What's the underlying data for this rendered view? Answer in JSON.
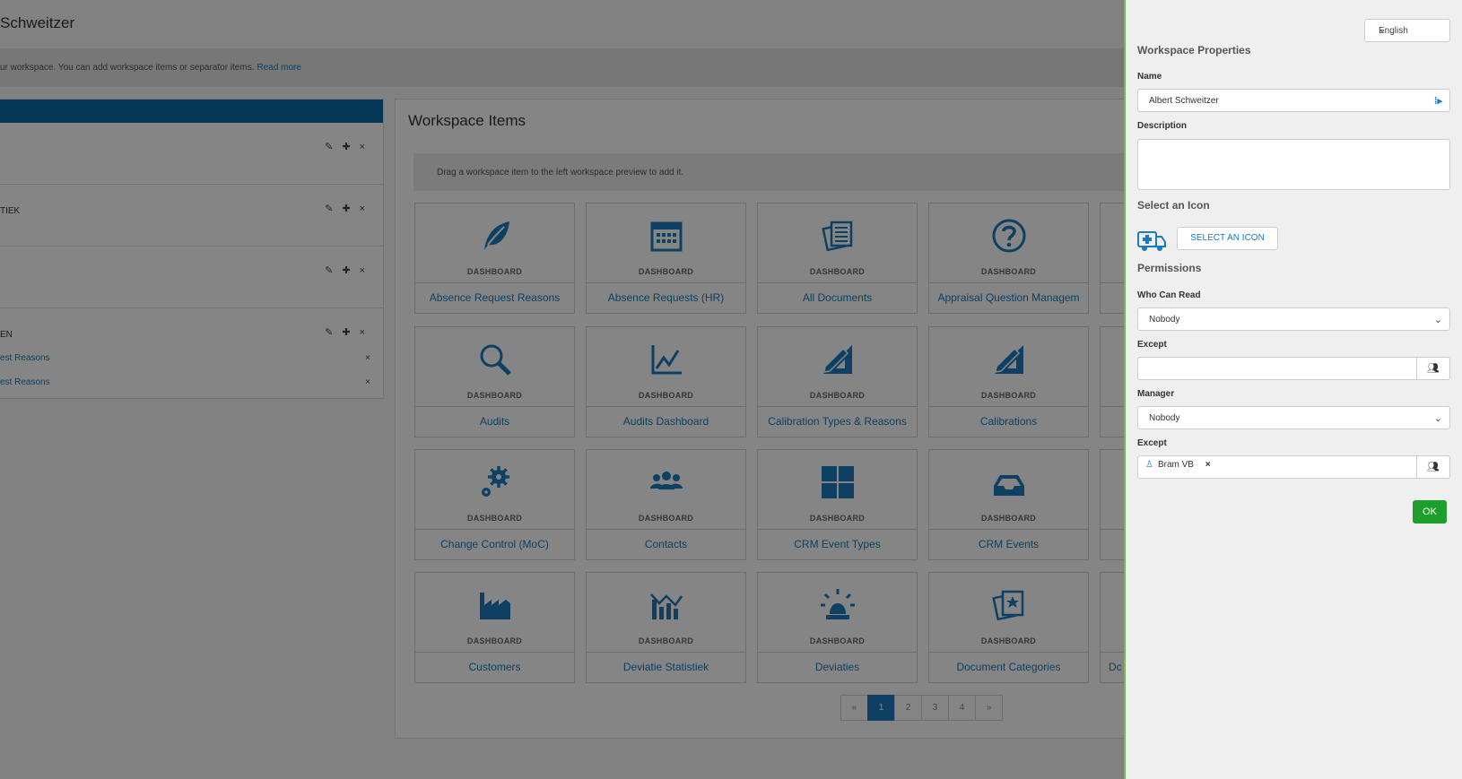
{
  "app": {
    "title": "Schweitzer",
    "info_text": "ur workspace. You can add workspace items or separator items.",
    "read_more": "Read more"
  },
  "left_preview": {
    "rows": [
      {
        "label": ""
      },
      {
        "label": "TIEK"
      },
      {
        "label": ""
      },
      {
        "label": "EN"
      }
    ],
    "sub_items": [
      "est Reasons",
      "est Reasons"
    ],
    "remove_glyph": "×"
  },
  "items": {
    "title": "Workspace Items",
    "drag_hint": "Drag a workspace item to the left workspace preview to add it.",
    "tiles": [
      {
        "kind": "DASHBOARD",
        "name": "Absence Request Reasons",
        "icon": "leaf-icon"
      },
      {
        "kind": "DASHBOARD",
        "name": "Absence Requests (HR)",
        "icon": "calendar-icon"
      },
      {
        "kind": "DASHBOARD",
        "name": "All Documents",
        "icon": "documents-icon"
      },
      {
        "kind": "DASHBOARD",
        "name": "Appraisal Question Managem",
        "icon": "question-icon"
      },
      {
        "kind": "DASHBOARD",
        "name": "Audits",
        "icon": "magnifier-icon"
      },
      {
        "kind": "DASHBOARD",
        "name": "Audits Dashboard",
        "icon": "line-chart-icon"
      },
      {
        "kind": "DASHBOARD",
        "name": "Calibration Types & Reasons",
        "icon": "ruler-pencil-icon"
      },
      {
        "kind": "DASHBOARD",
        "name": "Calibrations",
        "icon": "ruler-pencil-icon"
      },
      {
        "kind": "DASHBOARD",
        "name": "Change Control (MoC)",
        "icon": "gears-icon"
      },
      {
        "kind": "DASHBOARD",
        "name": "Contacts",
        "icon": "people-icon"
      },
      {
        "kind": "DASHBOARD",
        "name": "CRM Event Types",
        "icon": "grid-icon"
      },
      {
        "kind": "DASHBOARD",
        "name": "CRM Events",
        "icon": "inbox-icon"
      },
      {
        "kind": "DASHBOARD",
        "name": "Customers",
        "icon": "factory-icon"
      },
      {
        "kind": "DASHBOARD",
        "name": "Deviatie Statistiek",
        "icon": "bar-chart-icon"
      },
      {
        "kind": "DASHBOARD",
        "name": "Deviaties",
        "icon": "siren-icon"
      },
      {
        "kind": "DASHBOARD",
        "name": "Document Categories",
        "icon": "star-documents-icon"
      }
    ],
    "partial_tile_text": "Dc",
    "pagination": [
      "«",
      "1",
      "2",
      "3",
      "4",
      "»"
    ],
    "active_page": "1"
  },
  "drawer": {
    "language": "English",
    "title": "Workspace Properties",
    "name_label": "Name",
    "name_value": "Albert Schweitzer",
    "description_label": "Description",
    "description_value": "",
    "icon_label": "Select an Icon",
    "icon_current": "ambulance-icon",
    "select_icon_button": "SELECT AN ICON",
    "permissions_title": "Permissions",
    "who_can_read_label": "Who Can Read",
    "who_can_read_value": "Nobody",
    "except_label": "Except",
    "except_value": "",
    "manager_label": "Manager",
    "manager_value": "Nobody",
    "except2_label": "Except",
    "except2_tag": "Bram VB",
    "except2_tag_remove": "×",
    "ok_button": "OK"
  },
  "colors": {
    "accent_blue": "#1a7bbd",
    "header_blue": "#0b6ba8",
    "ok_green": "#1e9f2c",
    "drawer_border": "#6abf4b"
  }
}
